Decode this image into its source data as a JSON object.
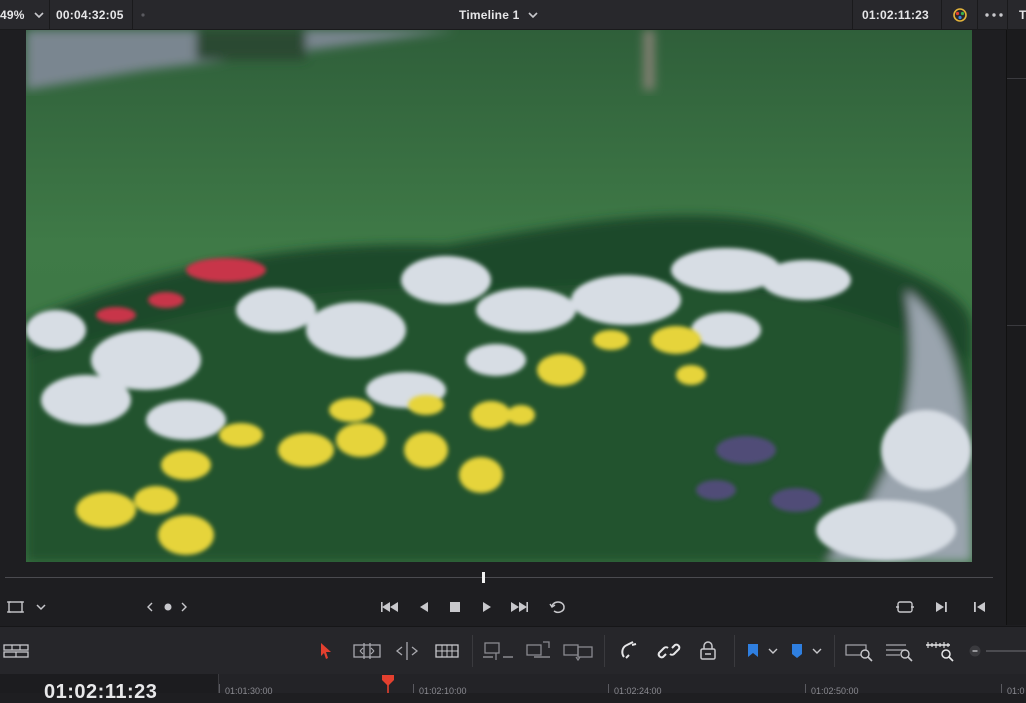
{
  "header": {
    "zoom": "49%",
    "source_timecode": "00:04:32:05",
    "timeline_name": "Timeline 1",
    "record_timecode": "01:02:11:23",
    "right_clip_letter": "T"
  },
  "timeline": {
    "current_timecode": "01:02:11:23",
    "ruler_labels": [
      "01:01:30:00",
      "01:02:10:00",
      "01:02:24:00",
      "01:02:50:00",
      "01:0"
    ]
  },
  "colors": {
    "accent_blue": "#2f7fe0",
    "playhead_red": "#e4402f",
    "select_red": "#e4402f"
  }
}
